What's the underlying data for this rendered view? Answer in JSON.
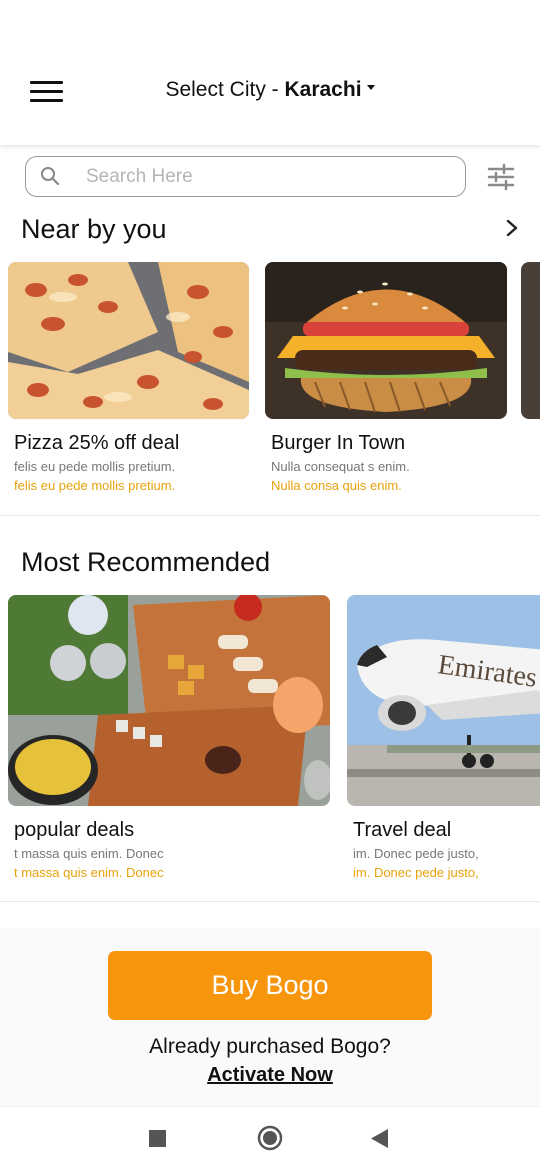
{
  "header": {
    "city_prefix": "Select City - ",
    "city_name": "Karachi",
    "menu_icon": "hamburger-menu-icon",
    "caret_icon": "caret-down-icon"
  },
  "search": {
    "placeholder": "Search Here",
    "value": "",
    "icon": "search-icon",
    "filter_icon": "sliders-filter-icon"
  },
  "nearby": {
    "title": "Near by you",
    "more_icon": "chevron-right-icon",
    "cards": [
      {
        "title": "Pizza 25% off deal",
        "subtitle": "felis eu pede mollis pretium.",
        "highlight": "felis eu pede mollis pretium.",
        "image": "pizza-photo"
      },
      {
        "title": "Burger In Town",
        "subtitle": "Nulla consequat s enim.",
        "highlight": "Nulla consa quis enim.",
        "image": "burger-photo"
      }
    ]
  },
  "recommended": {
    "title": "Most Recommended",
    "cards": [
      {
        "title": "popular deals",
        "subtitle": "t massa quis enim. Donec",
        "highlight": "t massa quis enim. Donec",
        "image": "food-platter-photo"
      },
      {
        "title": "Travel deal",
        "subtitle": "im. Donec pede justo,",
        "highlight": "im. Donec pede justo,",
        "image": "airplane-photo"
      }
    ]
  },
  "bogo": {
    "button_label": "Buy Bogo",
    "already_text": "Already purchased Bogo?",
    "activate_label": "Activate Now"
  },
  "navbar": {
    "icons": [
      "square-recents-icon",
      "circle-home-icon",
      "triangle-back-icon"
    ]
  },
  "colors": {
    "accent": "#f7950d",
    "highlight_text": "#e8a20c",
    "muted_text": "#777777"
  }
}
